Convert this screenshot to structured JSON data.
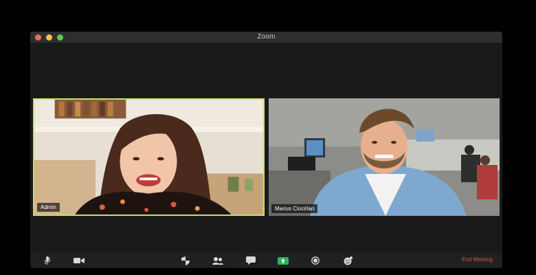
{
  "window": {
    "title": "Zoom"
  },
  "participants": [
    {
      "name": "Admin",
      "active_speaker": true
    },
    {
      "name": "Marius Ciocirlan",
      "active_speaker": false
    }
  ],
  "toolbar": {
    "end_meeting_label": "End Meeting",
    "icons": [
      "microphone-icon",
      "video-camera-icon",
      "shield-icon",
      "participants-icon",
      "chat-icon",
      "share-screen-icon",
      "record-icon",
      "reactions-icon"
    ]
  },
  "colors": {
    "active_speaker_border": "#c9e06a",
    "end_meeting": "#e1524a",
    "share_screen": "#2db55d"
  }
}
